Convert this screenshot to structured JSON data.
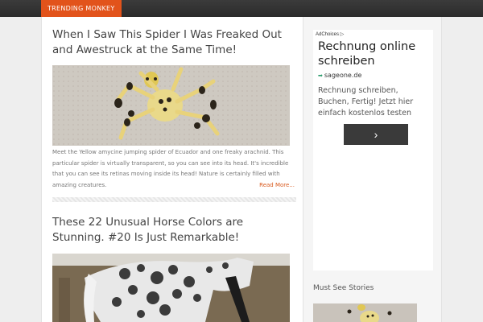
{
  "site": {
    "brand": "TRENDING MONKEY"
  },
  "posts": [
    {
      "title": "When I Saw This Spider I Was Freaked Out and Awestruck at the Same Time!",
      "image": "spider",
      "excerpt": "Meet the Yellow amycine jumping spider of Ecuador and one freaky arachnid. This particular spider is virtually transparent, so you can see into its head. It's incredible that you can see its retinas moving inside its head! Nature is certainly filled with amazing creatures.",
      "read_more": "Read More..."
    },
    {
      "title": "These 22 Unusual Horse Colors are Stunning. #20 Is Just Remarkable!",
      "image": "horse"
    }
  ],
  "ad": {
    "adchoices": "AdChoices",
    "adchoices_icon": "adchoices-triangle-icon",
    "title": "Rechnung online schreiben",
    "domain": "sageone.de",
    "domain_icon": "arrow-right-icon",
    "body": "Rechnung schreiben, Buchen, Fertig! Jetzt hier einfach kostenlos testen",
    "button_icon": "chevron-right-icon",
    "button_glyph": "›"
  },
  "sidebar": {
    "heading": "Must See Stories"
  },
  "colors": {
    "accent": "#e2531b",
    "topbar": "#2f2f2f",
    "button": "#3a3a3a"
  }
}
